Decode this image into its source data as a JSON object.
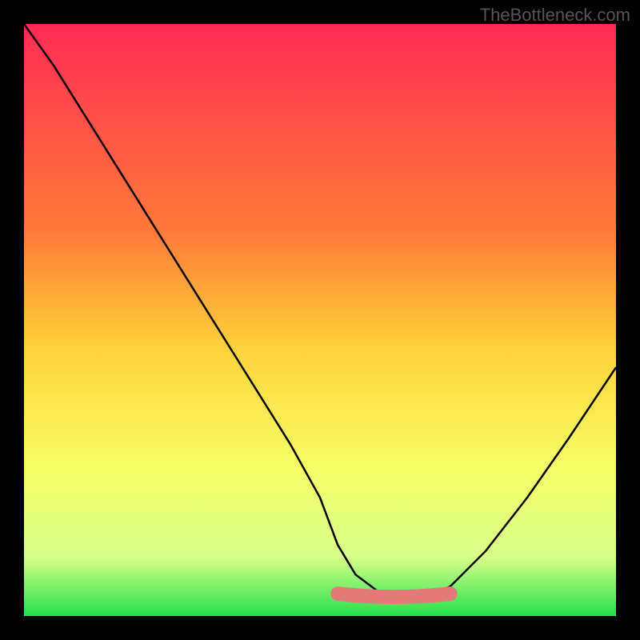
{
  "attribution": "TheBottleneck.com",
  "chart_data": {
    "type": "line",
    "title": "",
    "xlabel": "",
    "ylabel": "",
    "xlim": [
      0,
      100
    ],
    "ylim": [
      0,
      100
    ],
    "gradient_stops": [
      {
        "offset": 0,
        "color": "#ff2b55"
      },
      {
        "offset": 35,
        "color": "#ff7a3a"
      },
      {
        "offset": 55,
        "color": "#ffd23a"
      },
      {
        "offset": 75,
        "color": "#f6ff68"
      },
      {
        "offset": 90,
        "color": "#d8ff8a"
      },
      {
        "offset": 100,
        "color": "#25e04e"
      }
    ],
    "series": [
      {
        "name": "bottleneck-curve",
        "color": "#000000",
        "x": [
          0,
          5,
          10,
          15,
          20,
          25,
          30,
          35,
          40,
          45,
          50,
          53,
          56,
          60,
          64,
          68,
          72,
          78,
          85,
          92,
          100
        ],
        "y": [
          100,
          93,
          85,
          77,
          69,
          61,
          53,
          45,
          37,
          29,
          20,
          12,
          7,
          4,
          3,
          3,
          5,
          11,
          20,
          30,
          42
        ]
      }
    ],
    "highlight_band": {
      "name": "optimal-range",
      "color": "#e37a7a",
      "x_start": 53,
      "x_end": 72,
      "y": 3.5,
      "thickness": 2.4
    }
  }
}
